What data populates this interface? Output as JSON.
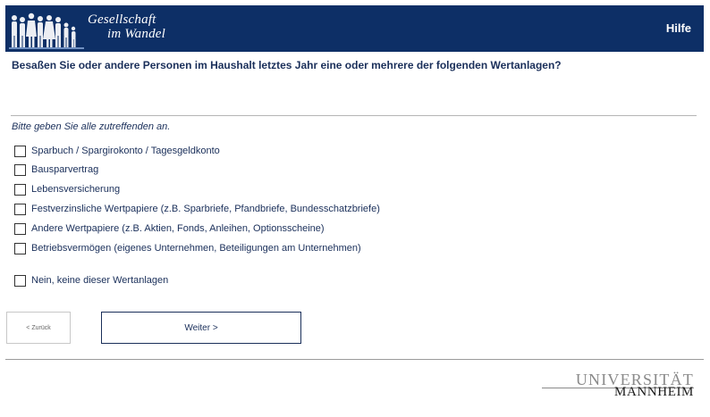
{
  "header": {
    "logo_line1": "Gesellschaft",
    "logo_line2": "im Wandel",
    "help_label": "Hilfe"
  },
  "question": "Besaßen Sie oder andere Personen im Haushalt letztes Jahr eine oder mehrere der folgenden Wertanlagen?",
  "instruction": "Bitte geben Sie alle zutreffenden an.",
  "options": [
    {
      "label": "Sparbuch / Spargirokonto / Tagesgeldkonto",
      "checked": false
    },
    {
      "label": "Bausparvertrag",
      "checked": false
    },
    {
      "label": "Lebensversicherung",
      "checked": false
    },
    {
      "label": "Festverzinsliche Wertpapiere (z.B. Sparbriefe, Pfandbriefe, Bundesschatzbriefe)",
      "checked": false
    },
    {
      "label": "Andere Wertpapiere (z.B. Aktien, Fonds, Anleihen, Optionsscheine)",
      "checked": false
    },
    {
      "label": "Betriebsvermögen (eigenes Unternehmen, Beteiligungen am Unternehmen)",
      "checked": false
    },
    {
      "label": "Nein, keine dieser Wertanlagen",
      "checked": false
    }
  ],
  "nav": {
    "back_label": "< Zurück",
    "next_label": "Weiter >"
  },
  "footer": {
    "university_line1": "UNIVERSITÄT",
    "university_line2": "MANNHEIM"
  },
  "colors": {
    "header_bg": "#0d2f66",
    "text": "#1a2f5a"
  }
}
